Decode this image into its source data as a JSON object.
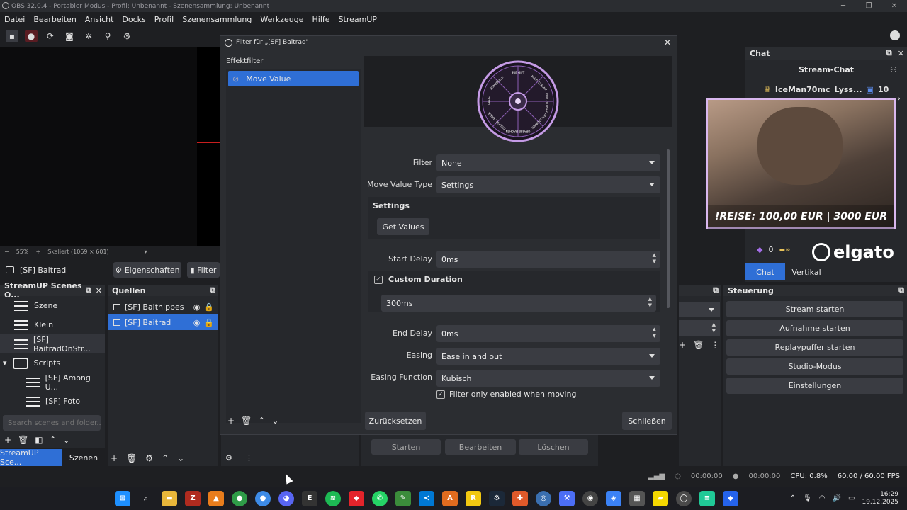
{
  "titlebar": {
    "title": "OBS 32.0.4 - Portabler Modus - Profil: Unbenannt - Szenensammlung: Unbenannt",
    "minimize": "─",
    "maximize": "❐",
    "close": "✕"
  },
  "menu": [
    "Datei",
    "Bearbeiten",
    "Ansicht",
    "Docks",
    "Profil",
    "Szenensammlung",
    "Werkzeuge",
    "Hilfe",
    "StreamUP"
  ],
  "preview": {
    "zoom_minus": "−",
    "zoom": "55%",
    "zoom_plus": "+",
    "scale": "Skaliert (1069 × 601)"
  },
  "source_bar": {
    "selected": "[SF] Baitrad",
    "properties": "Eigenschaften",
    "filters": "Filter"
  },
  "scenes_dock": {
    "title": "StreamUP Scenes O...",
    "items": [
      "Szene",
      "Klein",
      "[SF] BaitradOnStr..."
    ],
    "folder": "Scripts",
    "folder_items": [
      "[SF] Among U...",
      "[SF] Foto"
    ],
    "search_placeholder": "Search scenes and folder...",
    "tabs": [
      "StreamUP Sce...",
      "Szenen"
    ]
  },
  "sources_dock": {
    "title": "Quellen",
    "items": [
      "[SF] Baitnippes",
      "[SF] Baitrad"
    ]
  },
  "dialog": {
    "title": "Filter für „[SF] Baitrad\"",
    "effects_label": "Effektfilter",
    "effects": [
      "Move Value"
    ],
    "wheel_segments": [
      "SUB GIFT",
      "HOLD STREAM",
      "ROB ZU USER",
      "ZEIT STOPPEN",
      "GRASSE MACHEN",
      "KOSTÜM / FARBE",
      "PREIS",
      "BONUSGELD"
    ],
    "fields": {
      "filter_label": "Filter",
      "filter_value": "None",
      "type_label": "Move Value Type",
      "type_value": "Settings",
      "settings_header": "Settings",
      "get_values": "Get Values",
      "start_delay_label": "Start Delay",
      "start_delay_value": "0ms",
      "custom_duration_label": "Custom Duration",
      "custom_duration_value": "300ms",
      "end_delay_label": "End Delay",
      "end_delay_value": "0ms",
      "easing_label": "Easing",
      "easing_value": "Ease in and out",
      "easing_function_label": "Easing Function",
      "easing_function_value": "Kubisch",
      "only_moving_label": "Filter only enabled when moving"
    },
    "reset": "Zurücksetzen",
    "close_button": "Schließen"
  },
  "chat": {
    "title": "Chat",
    "stream_chat": "Stream-Chat",
    "user1": "IceMan70mc",
    "user2": "Lyss...",
    "count": "10",
    "overlay_text": "!REISE: 100,00 EUR | 3000 EUR",
    "counter": "0",
    "brand": "elgato",
    "tabs": [
      "Chat",
      "Vertikal"
    ]
  },
  "controls": {
    "title": "Steuerung",
    "buttons": [
      "Stream starten",
      "Aufnahme starten",
      "Replaypuffer starten",
      "Studio-Modus",
      "Einstellungen"
    ]
  },
  "under_dialog": {
    "buttons": [
      "Starten",
      "Bearbeiten",
      "Löschen"
    ]
  },
  "statusbar": {
    "time1": "00:00:00",
    "time2": "00:00:00",
    "cpu": "CPU: 0.8%",
    "fps": "60.00 / 60.00 FPS"
  },
  "taskbar": {
    "time": "16:29",
    "date": "19.12.2025"
  }
}
